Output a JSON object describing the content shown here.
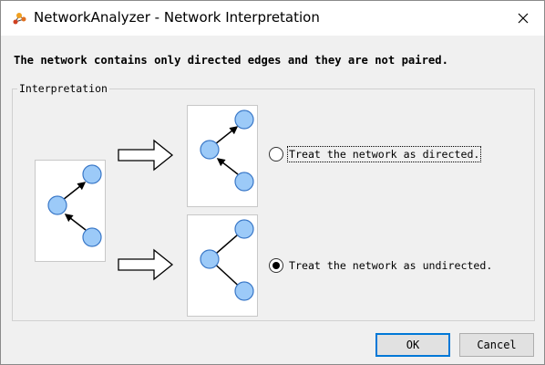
{
  "window": {
    "title": "NetworkAnalyzer - Network Interpretation",
    "icon": "network-analyzer-app-icon",
    "close_icon": "close-icon"
  },
  "headline": "The network contains only directed edges and they are not paired.",
  "interpretation": {
    "label": "Interpretation",
    "options": [
      {
        "label": "Treat the network as directed.",
        "selected": false,
        "focused": true
      },
      {
        "label": "Treat the network as undirected.",
        "selected": true,
        "focused": false
      }
    ]
  },
  "buttons": {
    "ok": "OK",
    "cancel": "Cancel"
  },
  "colors": {
    "node_fill": "#9ccaf8",
    "node_stroke": "#3a78c8",
    "focus_border": "#0078d7",
    "dialog_bg": "#f0f0f0"
  }
}
